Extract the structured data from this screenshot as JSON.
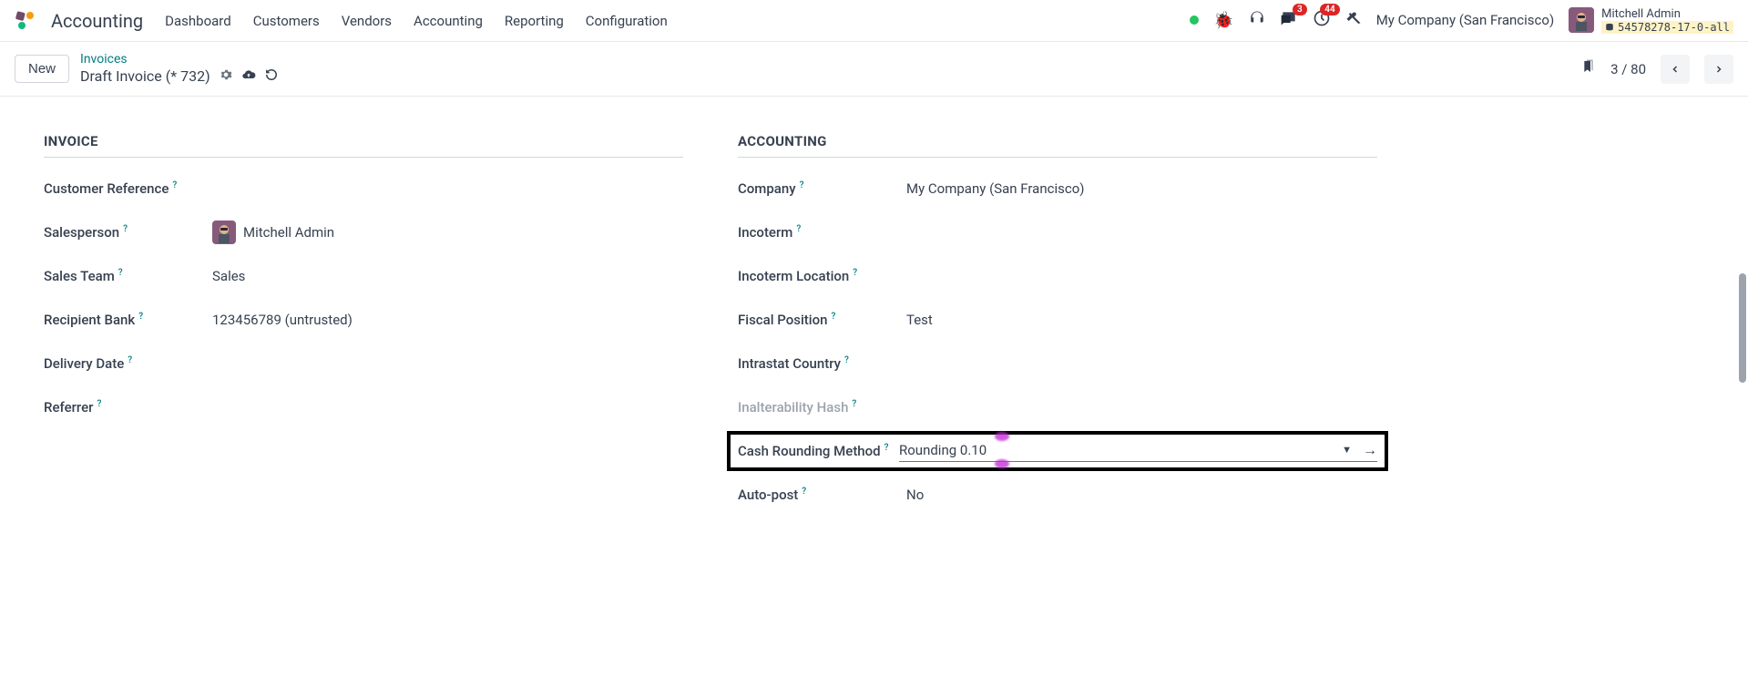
{
  "header": {
    "app_title": "Accounting",
    "nav": [
      "Dashboard",
      "Customers",
      "Vendors",
      "Accounting",
      "Reporting",
      "Configuration"
    ],
    "chat_badge": "3",
    "clock_badge": "44",
    "company": "My Company (San Francisco)",
    "user_name": "Mitchell Admin",
    "user_db": "54578278-17-0-all"
  },
  "subheader": {
    "new_label": "New",
    "breadcrumb_link": "Invoices",
    "breadcrumb_current": "Draft Invoice (* 732)",
    "pager": "3 / 80"
  },
  "invoice": {
    "section_title": "INVOICE",
    "customer_reference_label": "Customer Reference",
    "salesperson_label": "Salesperson",
    "salesperson_value": "Mitchell Admin",
    "sales_team_label": "Sales Team",
    "sales_team_value": "Sales",
    "recipient_bank_label": "Recipient Bank",
    "recipient_bank_value": "123456789 (untrusted)",
    "delivery_date_label": "Delivery Date",
    "referrer_label": "Referrer"
  },
  "accounting": {
    "section_title": "ACCOUNTING",
    "company_label": "Company",
    "company_value": "My Company (San Francisco)",
    "incoterm_label": "Incoterm",
    "incoterm_location_label": "Incoterm Location",
    "fiscal_position_label": "Fiscal Position",
    "fiscal_position_value": "Test",
    "intrastat_country_label": "Intrastat Country",
    "inalterability_hash_label": "Inalterability Hash",
    "cash_rounding_label": "Cash Rounding Method",
    "cash_rounding_value": "Rounding 0.10",
    "auto_post_label": "Auto-post",
    "auto_post_value": "No"
  }
}
